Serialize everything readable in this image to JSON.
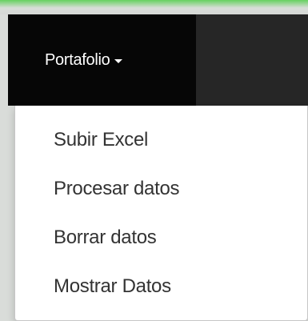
{
  "navbar": {
    "menu_label": "Portafolio",
    "caret_icon": "caret-down-icon"
  },
  "dropdown": {
    "items": [
      {
        "label": "Subir Excel"
      },
      {
        "label": "Procesar datos"
      },
      {
        "label": "Borrar datos"
      },
      {
        "label": "Mostrar Datos"
      }
    ]
  },
  "colors": {
    "navbar_background": "#262626",
    "active_item_background": "#060606",
    "menu_text": "#ffffff",
    "dropdown_text": "#333333",
    "dropdown_background": "#ffffff"
  }
}
